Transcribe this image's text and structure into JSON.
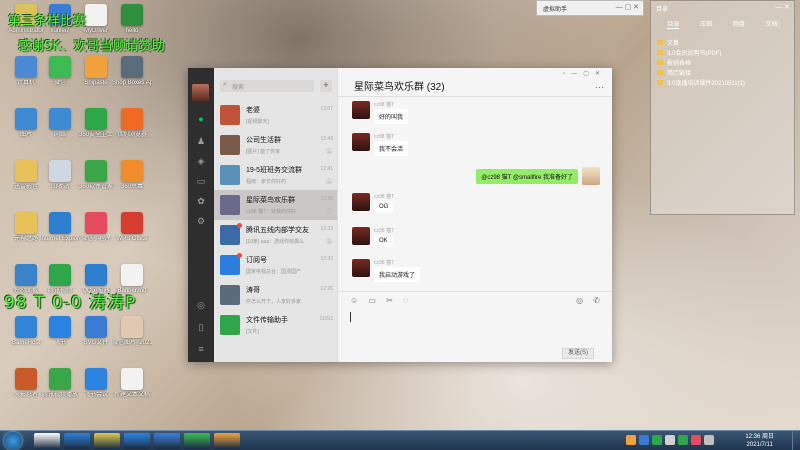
{
  "overlay": {
    "line1": "第三条样比赛",
    "line2": "感谢SK、欢哥当顾请赞助",
    "score": "98 T 0-0 涛涛P"
  },
  "desktop": {
    "icons": [
      {
        "label": "Administrator",
        "color": "#d9c35a"
      },
      {
        "label": "xunlei7",
        "color": "#3a7bd5"
      },
      {
        "label": "MyDriver",
        "color": "#f2f2f2"
      },
      {
        "label": "hello",
        "color": "#2f8f3e"
      },
      {
        "label": "计算机",
        "color": "#4a8ad4"
      },
      {
        "label": "微信",
        "color": "#3cba54"
      },
      {
        "label": "Snipaste",
        "color": "#f2a23c"
      },
      {
        "label": "Shop Boxes Apps",
        "color": "#5a6b7c"
      },
      {
        "label": "图片",
        "color": "#3e8bd3"
      },
      {
        "label": "网络",
        "color": "#3e8bd3"
      },
      {
        "label": "360安全卫士",
        "color": "#2ea74a"
      },
      {
        "label": "猎豹浏览器",
        "color": "#f06a25"
      },
      {
        "label": "迅雷影音",
        "color": "#e8c15a"
      },
      {
        "label": "回收站",
        "color": "#cfd8e2"
      },
      {
        "label": "360软件管家",
        "color": "#3aa64a"
      },
      {
        "label": "360杀毒",
        "color": "#f08d2a"
      },
      {
        "label": "元神之路",
        "color": "#e8c15a"
      },
      {
        "label": "Internet Explorer",
        "color": "#2f7fd1"
      },
      {
        "label": "微信小程序",
        "color": "#e64a5e"
      },
      {
        "label": "WPS Office",
        "color": "#d83c31"
      },
      {
        "label": "控制面板",
        "color": "#3b83c9"
      },
      {
        "label": "腾讯视频",
        "color": "#2ea74a"
      },
      {
        "label": "QQ浏览器",
        "color": "#2f7fd1"
      },
      {
        "label": "Banner.md",
        "color": "#f2f2f2"
      },
      {
        "label": "BameHost",
        "color": "#2f86d6"
      },
      {
        "label": "飞书",
        "color": "#2b82e0"
      },
      {
        "label": "SVG文件",
        "color": "#3a7bd5"
      },
      {
        "label": "微信图片_20210711",
        "color": "#e0c8b2"
      },
      {
        "label": "火影忍者",
        "color": "#c85a2a"
      },
      {
        "label": "腾讯视频播放",
        "color": "#3aa64a"
      },
      {
        "label": "飞书会议",
        "color": "#2b82e0"
      },
      {
        "label": "新建文本文档",
        "color": "#f2f2f2"
      }
    ]
  },
  "miniwin": {
    "title": "虚拟助手"
  },
  "dirwin": {
    "title": "目录",
    "tabs": [
      "目录",
      "压缩",
      "网盘",
      "文档"
    ],
    "items": [
      "文集",
      "3.0会员说明书(PDF)",
      "报销表格",
      "简历链接",
      "3.0直播培训课件20210511(1)"
    ]
  },
  "wechat": {
    "search_placeholder": "搜索",
    "chats": [
      {
        "name": "老婆",
        "preview": "[视频聊天]",
        "time": "13:07",
        "color": "#c0533a",
        "dot": false,
        "mute": false
      },
      {
        "name": "公司生活群",
        "preview": "[图片] 能了你家",
        "time": "12:48",
        "color": "#7a5a4a",
        "dot": false,
        "mute": true
      },
      {
        "name": "19-5班班务交流群",
        "preview": "程雨：家长你好的",
        "time": "12:41",
        "color": "#5a8fb8",
        "dot": false,
        "mute": true
      },
      {
        "name": "星际菜鸟欢乐群",
        "preview": "cz98 猫T：就我的你好",
        "time": "12:36",
        "color": "#6a6a8a",
        "dot": false,
        "mute": true
      },
      {
        "name": "腾讯五线内部学交友",
        "preview": "[10条] aaa：游戏你就做么",
        "time": "12:33",
        "color": "#3a6aa8",
        "dot": true,
        "mute": true
      },
      {
        "name": "订阅号",
        "preview": "国家电视总台：国漫国产",
        "time": "12:33",
        "color": "#2b7de0",
        "dot": true,
        "mute": false
      },
      {
        "name": "涛哥",
        "preview": "你怎么开下，人家好多家",
        "time": "12:26",
        "color": "#5a6a7a",
        "dot": false,
        "mute": false
      },
      {
        "name": "文件传输助手",
        "preview": "[文件]",
        "time": "11/5/3",
        "color": "#2ea74a",
        "dot": false,
        "mute": false
      }
    ],
    "title": "星际菜鸟欢乐群 (32)",
    "messages": [
      {
        "sender": "cz98 猫T",
        "text": "好的叫我",
        "side": "left"
      },
      {
        "sender": "cz98 猫T",
        "text": "我不会活",
        "side": "left"
      },
      {
        "sender": "",
        "text": "@cz98 猫T @smallfire 我准备好了",
        "side": "right"
      },
      {
        "sender": "cz98 猫T",
        "text": "OG",
        "side": "left"
      },
      {
        "sender": "cz98 猫T",
        "text": "OK",
        "side": "left"
      },
      {
        "sender": "cz98 猫T",
        "text": "我启动游戏了",
        "side": "left"
      }
    ],
    "send_label": "发送(S)"
  },
  "taskbar": {
    "clock_time": "12:36 周日",
    "clock_date": "2021/7/11",
    "pinned": [
      "#ffffff",
      "#2a7fd9",
      "#e0c84a",
      "#2b82e0",
      "#3a7bd5",
      "#3cba54",
      "#f2a23c"
    ]
  }
}
